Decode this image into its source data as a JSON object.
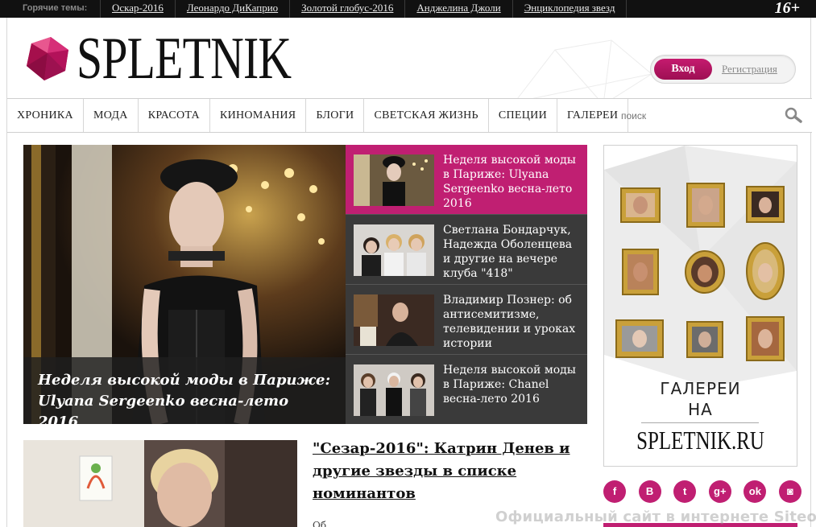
{
  "topbar": {
    "hot_label": "Горячие темы:",
    "hot_links": [
      "Оскар-2016",
      "Леонардо ДиКаприо",
      "Золотой глобус-2016",
      "Анджелина Джоли",
      "Энциклопедия звезд"
    ],
    "age_rating": "16+"
  },
  "header": {
    "logo_text": "SPLETNIK",
    "login_label": "Вход",
    "register_label": "Регистрация"
  },
  "nav": {
    "items": [
      "ХРОНИКА",
      "МОДА",
      "КРАСОТА",
      "КИНОМАНИЯ",
      "БЛОГИ",
      "СВЕТСКАЯ ЖИЗНЬ",
      "СПЕЦИИ",
      "ГАЛЕРЕИ"
    ],
    "search_placeholder": "поиск"
  },
  "featured": {
    "caption": "Неделя высокой моды в Париже: Ulyana Sergeenko весна-лето 2016"
  },
  "stories": [
    {
      "title": "Неделя высокой моды в Париже: Ulyana Sergeenko весна-лето 2016",
      "active": true
    },
    {
      "title": "Светлана Бондарчук, Надежда Оболенцева и другие на вечере клуба \"418\"",
      "active": false
    },
    {
      "title": "Владимир Познер: об антисемитизме, телевидении и уроках истории",
      "active": false
    },
    {
      "title": "Неделя высокой моды в Париже: Chanel весна-лето 2016",
      "active": false
    }
  ],
  "article2": {
    "title": "\"Сезар-2016\": Катрин Денев и другие звезды в списке номинантов",
    "excerpt_start": "Об"
  },
  "ad": {
    "line1": "ГАЛЕРЕИ",
    "line2": "НА",
    "brand": "SPLETNIK.RU"
  },
  "social": {
    "icons": [
      "facebook-icon",
      "vk-icon",
      "twitter-icon",
      "google-plus-icon",
      "odnoklassniki-icon",
      "instagram-icon"
    ],
    "glyphs": [
      "f",
      "B",
      "t",
      "g+",
      "ok",
      "◙"
    ]
  },
  "watermark": "Официальный сайт в интернете Siteofficial.ru",
  "colors": {
    "accent": "#c01f72",
    "dark": "#111111",
    "panel": "#3a3a3a"
  }
}
